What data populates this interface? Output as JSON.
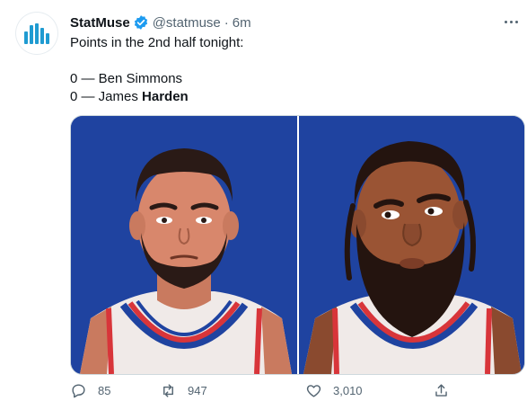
{
  "tweet": {
    "author_name": "StatMuse",
    "handle": "@statmuse",
    "separator": "·",
    "time": "6m",
    "text": {
      "line1": "Points in the 2nd half tonight:",
      "line2_prefix": "0 — Ben Simmons",
      "line3_prefix": "0 — James ",
      "line3_bold": "Harden"
    }
  },
  "media": {
    "left_panel": "ben-simmons-illustration",
    "right_panel": "james-harden-illustration",
    "background_color": "#1f43a0"
  },
  "actions": {
    "reply_count": "85",
    "retweet_count": "947",
    "like_count": "3,010"
  },
  "icons": {
    "verified": "verified-badge-icon",
    "more": "more-options-icon",
    "reply": "reply-icon",
    "retweet": "retweet-icon",
    "like": "heart-icon",
    "share": "share-icon"
  },
  "colors": {
    "text_primary": "#0f1419",
    "text_secondary": "#536471",
    "verified_blue": "#1d9bf0",
    "logo_teal": "#1f9bd1",
    "jersey_red": "#d8353a",
    "jersey_blue": "#1f43a0"
  }
}
